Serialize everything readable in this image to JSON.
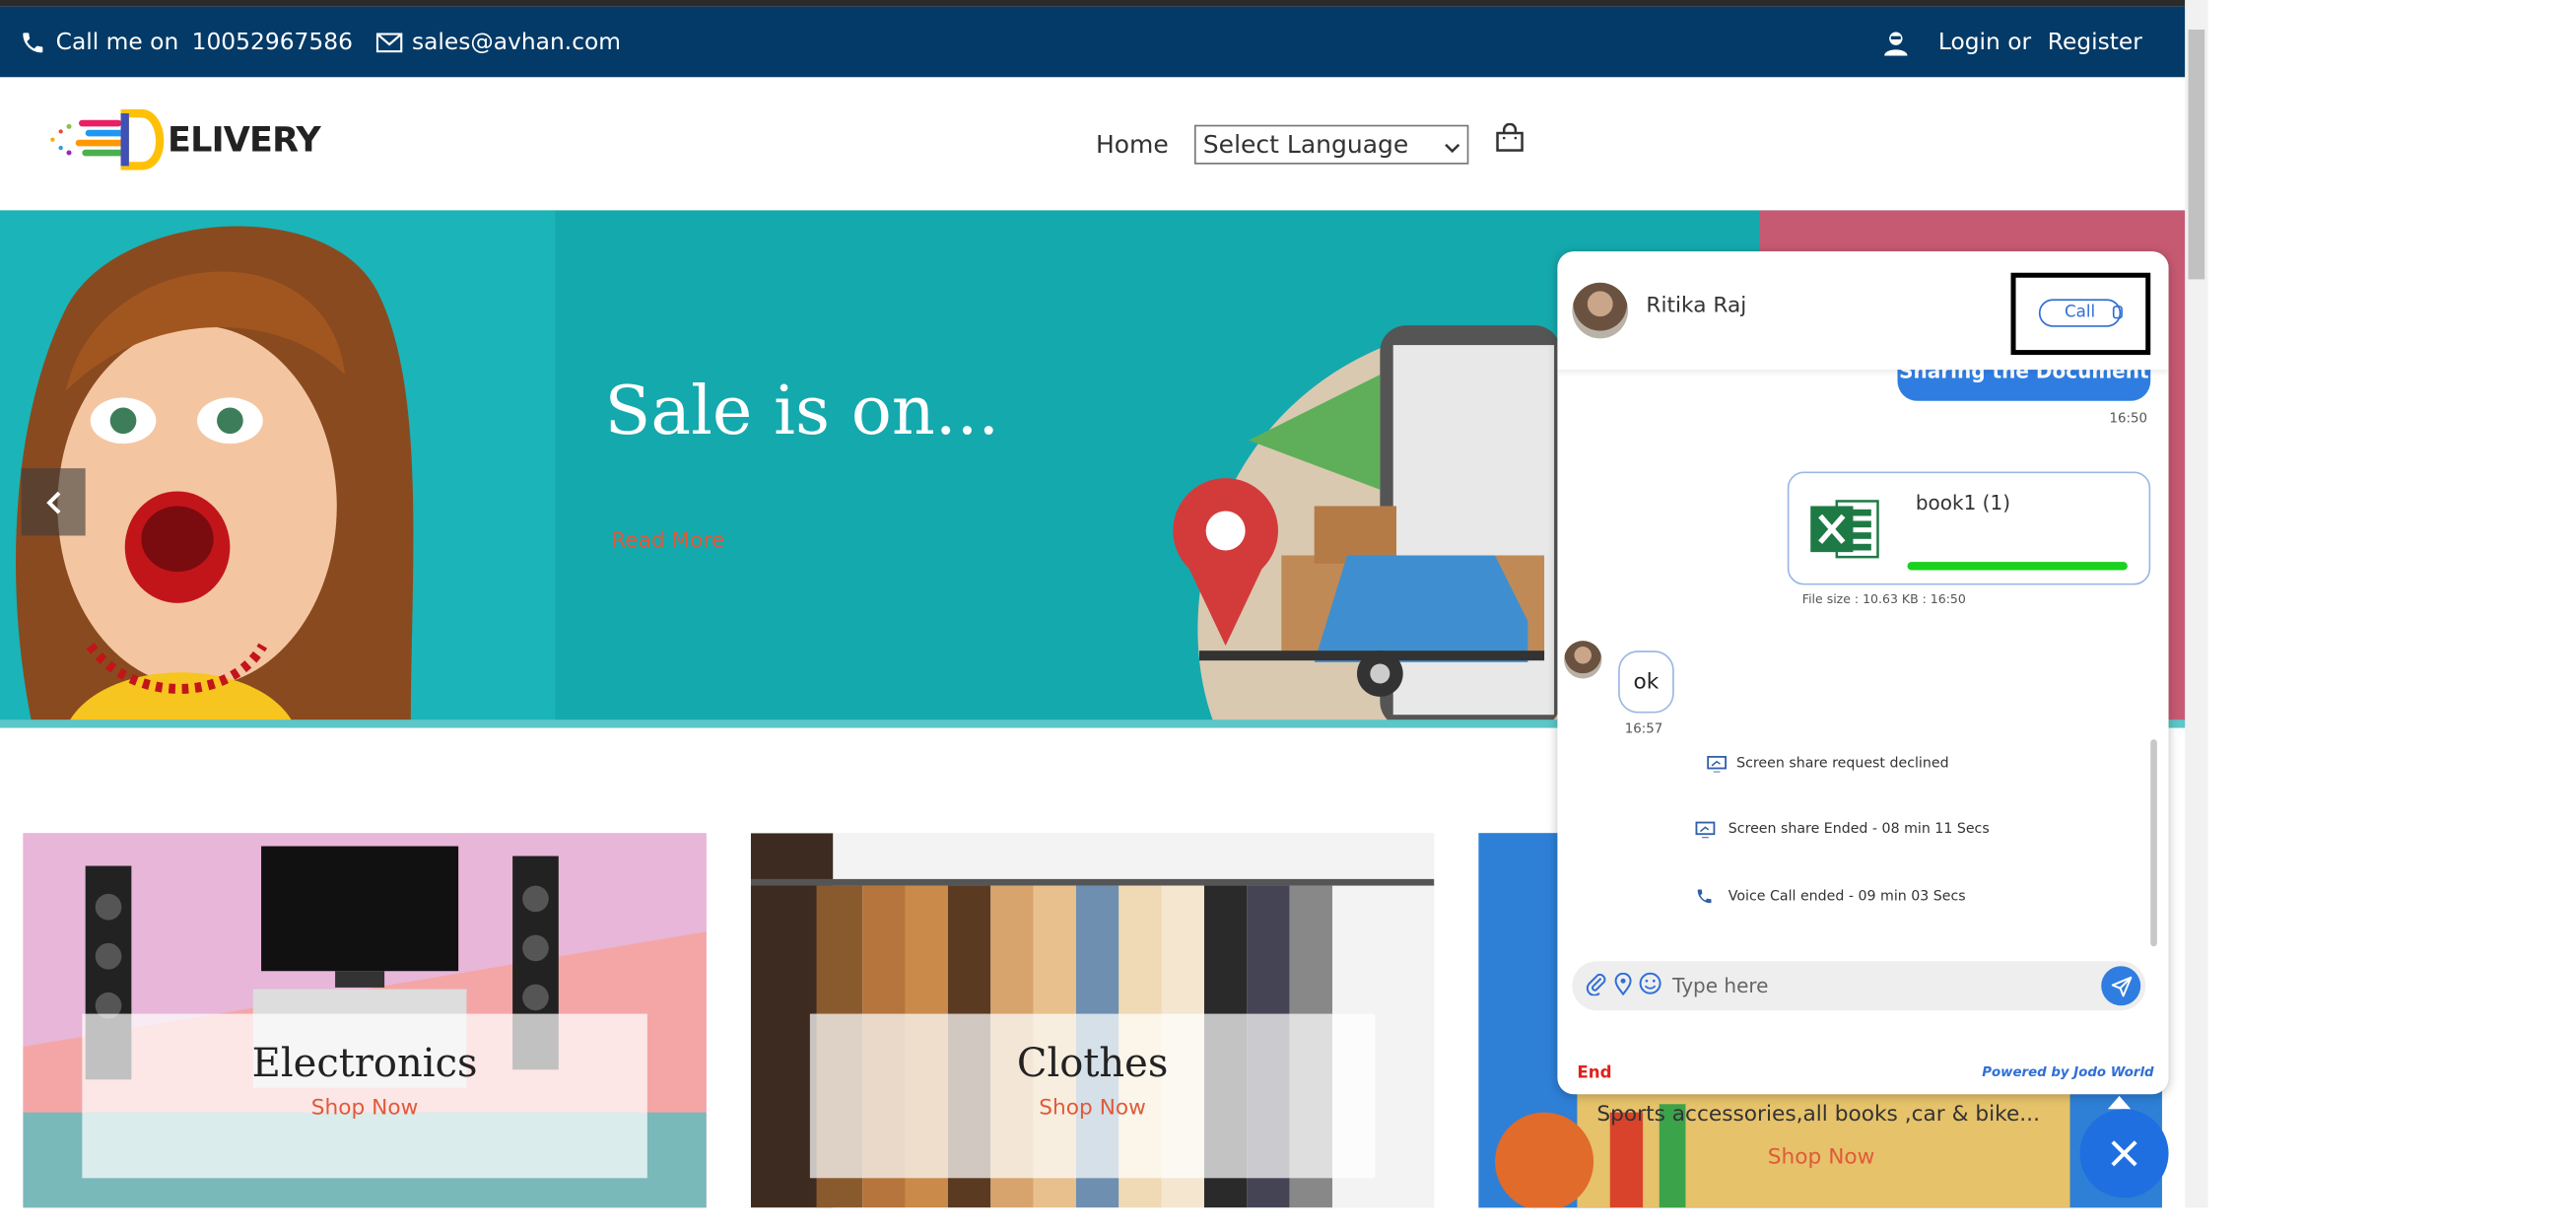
{
  "topbar": {
    "phone_label": "Call me on",
    "phone_number": "10052967586",
    "email": "sales@avhan.com",
    "login": "Login or",
    "register": "Register"
  },
  "header": {
    "logo_text": "ELIVERY",
    "logo_letter": "D",
    "nav_home": "Home",
    "language_select": "Select Language"
  },
  "hero": {
    "title": "Sale is on...",
    "link": "Read More"
  },
  "categories": [
    {
      "title": "Electronics",
      "link": "Shop Now"
    },
    {
      "title": "Clothes",
      "link": "Shop Now"
    },
    {
      "description": "Sports accessories,all books ,car & bike...",
      "link": "Shop Now"
    }
  ],
  "chat": {
    "agent_name": "Ritika Raj",
    "call_button": "Call",
    "outgoing_message": "Sharing the Document",
    "outgoing_time": "16:50",
    "file": {
      "name": "book1 (1)",
      "progress": 1.0,
      "meta": "File size : 10.63 KB : 16:50"
    },
    "incoming_message": "ok",
    "incoming_time": "16:57",
    "events": [
      {
        "icon": "screen-share-icon",
        "text": "Screen share request declined"
      },
      {
        "icon": "screen-share-icon",
        "text": "Screen share Ended - 08 min 11 Secs"
      },
      {
        "icon": "phone-icon",
        "text": "Voice Call ended - 09 min 03 Secs"
      }
    ],
    "input_placeholder": "Type here",
    "end_label": "End",
    "powered_by": "Powered by Jodo World"
  },
  "colors": {
    "topbar_bg": "#043a67",
    "accent_blue": "#2f7de1",
    "link_orange": "#e05a3a",
    "hero_teal": "#14a9ad",
    "progress_green": "#19d11e",
    "end_red": "#e2201e"
  }
}
